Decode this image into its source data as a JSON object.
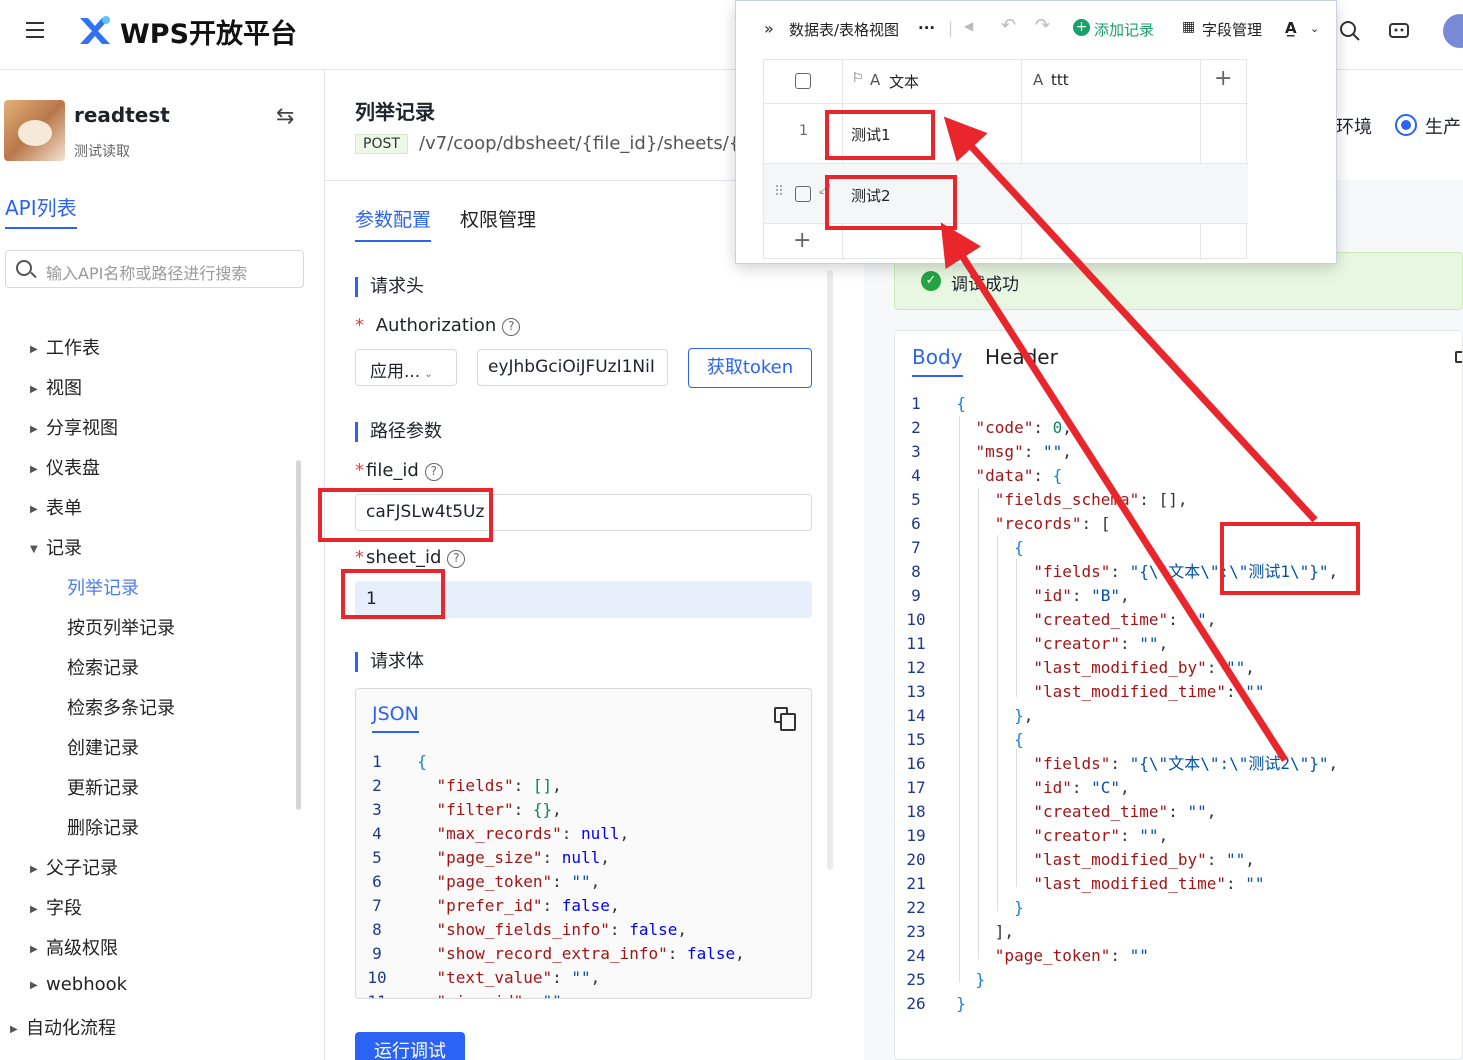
{
  "topbar": {
    "brand": "WPS开放平台"
  },
  "sidebar": {
    "app_name": "readtest",
    "app_sub": "测试读取",
    "api_tab": "API列表",
    "search_placeholder": "输入API名称或路径进行搜索",
    "nav": [
      "工作表",
      "视图",
      "分享视图",
      "仪表盘",
      "表单",
      "记录"
    ],
    "record_children": [
      "列举记录",
      "按页列举记录",
      "检索记录",
      "检索多条记录",
      "创建记录",
      "更新记录",
      "删除记录"
    ],
    "nav_after": [
      "父子记录",
      "字段",
      "高级权限",
      "webhook"
    ],
    "nav_root": "自动化流程"
  },
  "main": {
    "title": "列举记录",
    "method": "POST",
    "path": "/v7/coop/dbsheet/{file_id}/sheets/{she",
    "tabs": [
      "参数配置",
      "权限管理"
    ],
    "sec_header": "请求头",
    "auth_label": "Authorization",
    "auth_type": "应用...",
    "token_value": "eyJhbGciOiJFUzI1NiI",
    "token_button": "获取token",
    "sec_path": "路径参数",
    "file_id_label": "file_id",
    "file_id_value": "caFJSLw4t5Uz",
    "sheet_id_label": "sheet_id",
    "sheet_id_value": "1",
    "sec_body": "请求体",
    "json_tab": "JSON",
    "run_button": "运行调试"
  },
  "right": {
    "env_test": "环境",
    "env_prod": "生产",
    "success_text": "调试成功",
    "tabs": [
      "Body",
      "Header"
    ]
  },
  "popup": {
    "breadcrumb": "数据表/表格视图",
    "more": "···",
    "add_record": "添加记录",
    "field_manage": "字段管理",
    "col_text": "文本",
    "col_ttt": "ttt",
    "rows": [
      {
        "num": "1",
        "text": "测试1"
      },
      {
        "num": "",
        "text": "测试2"
      }
    ]
  },
  "colors": {
    "accent": "#2a63f5",
    "annotation": "#e8262c",
    "success_bg": "#e8f7e1"
  }
}
